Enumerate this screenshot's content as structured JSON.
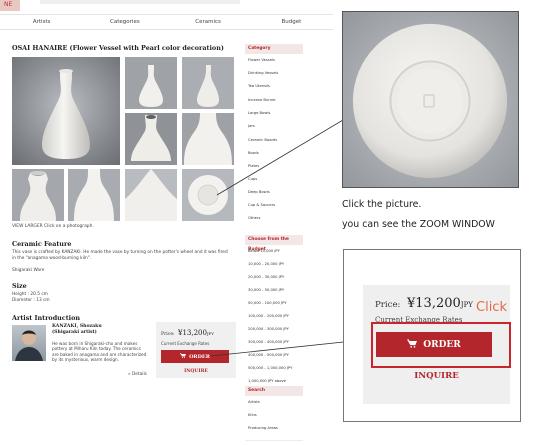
{
  "nav": {
    "items": [
      "Artists",
      "Categories",
      "Ceramics",
      "Budget"
    ]
  },
  "product": {
    "title": "OSAI HANAIRE (Flower Vessel with Pearl color decoration)",
    "caption": "VIEW LARGER Click on a photograph.",
    "feature_heading": "Ceramic Feature",
    "feature_text": "This vase is crafted by KANZAKI. He made the vase by turning on the potter's wheel and it was fired in the \"anagama wood-burning kiln\".",
    "ware": "Shigaraki Ware",
    "size_heading": "Size",
    "size_text_1": "Height : 20.5 cm",
    "size_text_2": "Diameter : 13 cm",
    "artist_heading": "Artist Introduction",
    "artist_name_1": "KANZAKI, Shozaku",
    "artist_name_2": "(Shigaraki artist)",
    "artist_bio": "He was born in Shigaraki-cho and makes pottery at Miharu Kiln today. The ceramics are baked in anagama and are characterized by its mysterious, warm design.",
    "details_link": "» Details"
  },
  "price": {
    "label": "Price:",
    "value": "¥13,200",
    "currency": "JPY",
    "rates": "Current Exchange Rates",
    "order": "ORDER",
    "inquire": "INQUIRE"
  },
  "sidebar": {
    "category_heading": "Category",
    "categories": [
      "Flower Vessels",
      "Drinking Vessels",
      "Tea Utensils",
      "Incense Burner",
      "Large Bowls",
      "Jars",
      "Ceramic Boards",
      "Bowls",
      "Plates",
      "Cups",
      "Deep Bowls",
      "Cup & Saucers",
      "Others"
    ],
    "budget_heading": "Choose from the Budget",
    "budgets": [
      "Below 10,000 JPY",
      "10,000 - 20,000 JPY",
      "20,000 - 30,000 JPY",
      "30,000 - 50,000 JPY",
      "50,000 - 100,000 JPY",
      "100,000 - 200,000 JPY",
      "200,000 - 300,000 JPY",
      "300,000 - 400,000 JPY",
      "400,000 - 500,000 JPY",
      "500,000 - 1,000,000 JPY",
      "1,000,000 JPY above"
    ],
    "search_heading": "Search",
    "search_items": [
      "Artists",
      "Kilns",
      "Producing Areas"
    ]
  },
  "instructions": {
    "line1": "Click the picture.",
    "line2": "you can see the ZOOM WINDOW"
  },
  "click_label": "Click",
  "colors": {
    "accent": "#b3272c",
    "highlight": "#c8262c",
    "click_text": "#e36a4a"
  }
}
